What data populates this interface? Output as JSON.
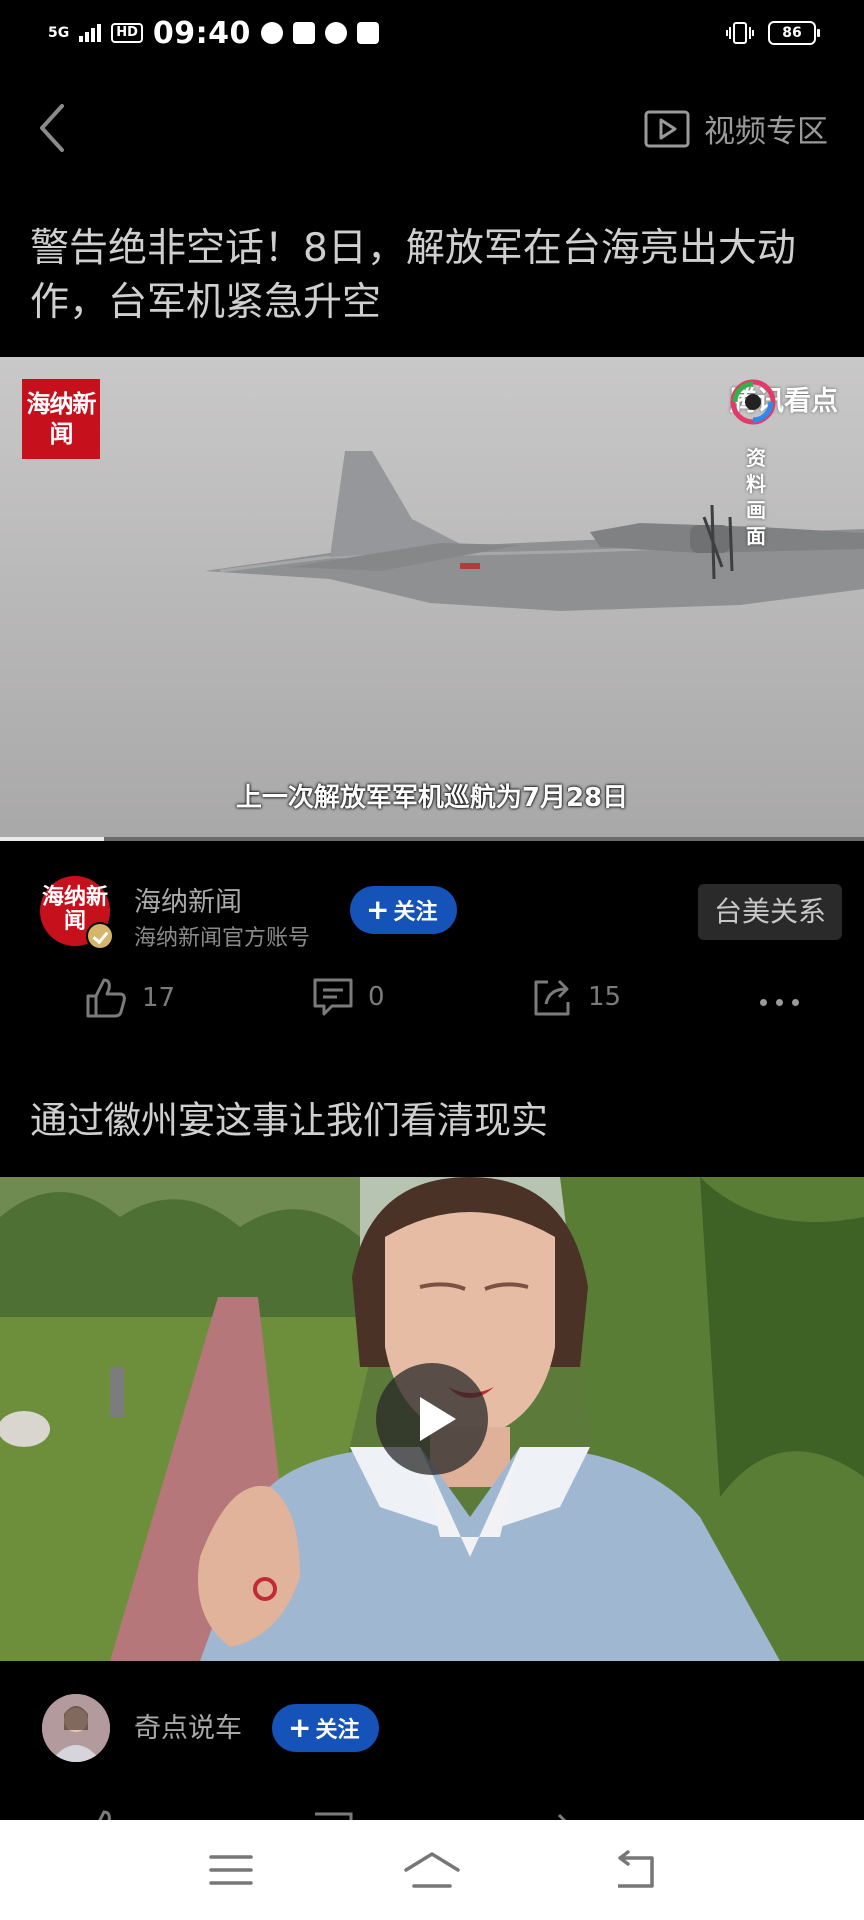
{
  "status_bar": {
    "network": "5G",
    "hd": "HD",
    "time": "09:40",
    "battery": "86"
  },
  "nav": {
    "video_zone_label": "视频专区"
  },
  "article1": {
    "title": "警告绝非空话！8日，解放军在台海亮出大动作，台军机紧急升空",
    "video": {
      "badge_text": "海纳新闻",
      "platform_logo": "腾讯看点",
      "archive_label": "资料画面",
      "subtitle": "上一次解放军军机巡航为7月28日",
      "progress": 0.12
    },
    "author": {
      "avatar_text": "海纳新闻",
      "name": "海纳新闻",
      "subtitle": "海纳新闻官方账号",
      "follow_label": "关注",
      "tag": "台美关系"
    },
    "actions": {
      "likes": "17",
      "comments": "0",
      "shares": "15"
    }
  },
  "article2": {
    "title": "通过徽州宴这事让我们看清现实",
    "author": {
      "name": "奇点说车",
      "follow_label": "关注"
    }
  },
  "colors": {
    "follow_blue": "#1553b8",
    "badge_red": "#c6111d",
    "background": "#000000"
  }
}
